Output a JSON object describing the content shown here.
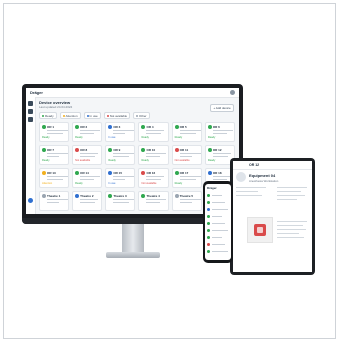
{
  "app": {
    "logo": "Dräger"
  },
  "page": {
    "title": "Device overview",
    "subtitle": "Last updated 24.04.2024",
    "new_button": "+ Add device"
  },
  "filters": [
    {
      "label": "Ready",
      "color": "#2fa84f"
    },
    {
      "label": "Attention",
      "color": "#f2b01e"
    },
    {
      "label": "In use",
      "color": "#2f6fd0"
    },
    {
      "label": "Not available",
      "color": "#d94b4b"
    },
    {
      "label": "Other",
      "color": "#9aa5b1"
    }
  ],
  "cards": [
    {
      "title": "OR 1",
      "color": "#2fa84f",
      "status": "Ready"
    },
    {
      "title": "OR 2",
      "color": "#2fa84f",
      "status": "Ready"
    },
    {
      "title": "OR 3",
      "color": "#2f6fd0",
      "status": "In use"
    },
    {
      "title": "OR 4",
      "color": "#2fa84f",
      "status": "Ready"
    },
    {
      "title": "OR 5",
      "color": "#2fa84f",
      "status": "Ready"
    },
    {
      "title": "OR 6",
      "color": "#2fa84f",
      "status": "Ready"
    },
    {
      "title": "OR 7",
      "color": "#2fa84f",
      "status": "Ready"
    },
    {
      "title": "OR 8",
      "color": "#d94b4b",
      "status": "Not available"
    },
    {
      "title": "OR 9",
      "color": "#2fa84f",
      "status": "Ready"
    },
    {
      "title": "OR 10",
      "color": "#2fa84f",
      "status": "Ready"
    },
    {
      "title": "OR 11",
      "color": "#d94b4b",
      "status": "Not available"
    },
    {
      "title": "OR 12",
      "color": "#2fa84f",
      "status": "Ready"
    },
    {
      "title": "OR 13",
      "color": "#f2b01e",
      "status": "Attention"
    },
    {
      "title": "OR 14",
      "color": "#2fa84f",
      "status": "Ready"
    },
    {
      "title": "OR 15",
      "color": "#2f6fd0",
      "status": "In use"
    },
    {
      "title": "OR 16",
      "color": "#d94b4b",
      "status": "Not available"
    },
    {
      "title": "OR 17",
      "color": "#2fa84f",
      "status": "Ready"
    },
    {
      "title": "OR 18",
      "color": "#2f6fd0",
      "status": "In use"
    },
    {
      "title": "Theatre 1",
      "color": "#9aa5b1",
      "status": ""
    },
    {
      "title": "Theatre 2",
      "color": "#2f6fd0",
      "status": ""
    },
    {
      "title": "Theatre 3",
      "color": "#2fa84f",
      "status": ""
    },
    {
      "title": "Theatre 4",
      "color": "#2fa84f",
      "status": ""
    },
    {
      "title": "Theatre 5",
      "color": "#9aa5b1",
      "status": ""
    },
    {
      "title": "Theatre 6",
      "color": "#2fa84f",
      "status": ""
    }
  ],
  "tablet": {
    "header": "OR 12",
    "device_name": "Equipment 04",
    "device_sub": "Anesthesia Workstation"
  },
  "phone": {
    "logo": "Dräger"
  }
}
